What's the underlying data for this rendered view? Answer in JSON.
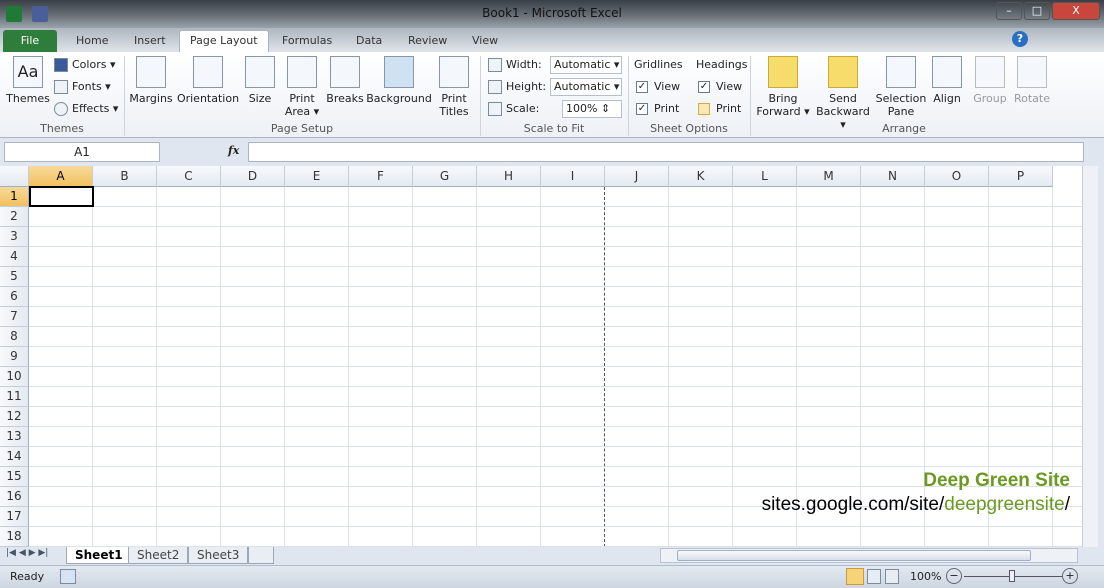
{
  "window": {
    "title": "Book1 - Microsoft Excel",
    "minimize": "–",
    "maximize": "□",
    "close": "X"
  },
  "tabs": {
    "file": "File",
    "items": [
      "Home",
      "Insert",
      "Page Layout",
      "Formulas",
      "Data",
      "Review",
      "View"
    ],
    "active": "Page Layout"
  },
  "ribbon": {
    "themes": {
      "themes": "Themes",
      "colors": "Colors ▾",
      "fonts": "Fonts ▾",
      "effects": "Effects ▾",
      "label": "Themes"
    },
    "page_setup": {
      "margins": "Margins",
      "orientation": "Orientation",
      "size": "Size",
      "print_area": "Print Area ▾",
      "print_area_1": "Print",
      "print_area_2": "Area ▾",
      "breaks": "Breaks",
      "background": "Background",
      "print_titles_1": "Print",
      "print_titles_2": "Titles",
      "label": "Page Setup"
    },
    "scale": {
      "width_label": "Width:",
      "width_value": "Automatic",
      "height_label": "Height:",
      "height_value": "Automatic",
      "scale_label": "Scale:",
      "scale_value": "100%",
      "label": "Scale to Fit"
    },
    "sheet_options": {
      "gridlines": "Gridlines",
      "headings": "Headings",
      "view": "View",
      "print": "Print",
      "gridlines_view": true,
      "gridlines_print": true,
      "headings_view": true,
      "headings_print": false,
      "label": "Sheet Options"
    },
    "arrange": {
      "bring_1": "Bring",
      "bring_2": "Forward ▾",
      "send_1": "Send",
      "send_2": "Backward ▾",
      "sel_1": "Selection",
      "sel_2": "Pane",
      "align": "Align",
      "group": "Group",
      "rotate": "Rotate",
      "label": "Arrange"
    }
  },
  "formula_bar": {
    "name_box": "A1",
    "fx": "fx",
    "value": ""
  },
  "grid": {
    "columns": [
      "A",
      "B",
      "C",
      "D",
      "E",
      "F",
      "G",
      "H",
      "I",
      "J",
      "K",
      "L",
      "M",
      "N",
      "O",
      "P"
    ],
    "rows": [
      "1",
      "2",
      "3",
      "4",
      "5",
      "6",
      "7",
      "8",
      "9",
      "10",
      "11",
      "12",
      "13",
      "14",
      "15",
      "16",
      "17",
      "18"
    ],
    "active_cell": "A1"
  },
  "sheets": {
    "tabs": [
      "Sheet1",
      "Sheet2",
      "Sheet3"
    ],
    "active": "Sheet1"
  },
  "status": {
    "ready": "Ready",
    "zoom": "100%"
  },
  "watermark": {
    "title": "Deep Green Site",
    "url_prefix": "sites.google.com/site/",
    "url_highlight": "deepgreensite",
    "url_suffix": "/"
  },
  "colors": {
    "accent": "#2f7d3a",
    "watermark": "#6a9a1f",
    "selection": "#f1c15f"
  }
}
